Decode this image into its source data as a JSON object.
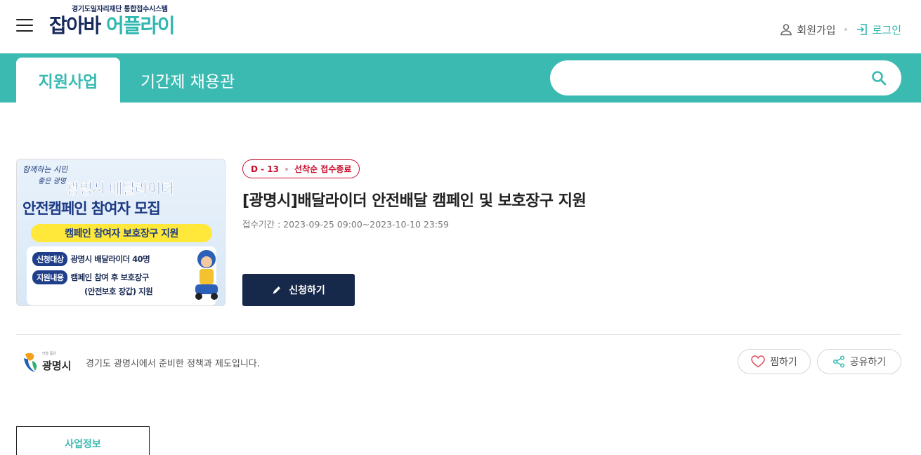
{
  "header": {
    "logo_subtitle": "경기도일자리재단 통합접수시스템",
    "logo_part1": "잡아바",
    "logo_part2": "어플라이",
    "signup_label": "회원가입",
    "login_label": "로그인"
  },
  "nav": {
    "tabs": [
      {
        "label": "지원사업",
        "active": true
      },
      {
        "label": "기간제 채용관",
        "active": false
      }
    ],
    "search": {
      "value": "",
      "placeholder": ""
    }
  },
  "program": {
    "dday": "D - 13",
    "status": "선착순 접수종료",
    "title": "[광명시]배달라이더 안전배달 캠페인 및 보호장구 지원",
    "period_label": "접수기간 :",
    "period_value": "2023-09-25 09:00~2023-10-10 23:59",
    "apply_label": "신청하기",
    "thumbnail": {
      "script_line1": "함께하는 시민",
      "script_line2": "좋은 광명",
      "headline1": "광명시 배달라이더",
      "headline2": "안전캠페인 참여자 모집",
      "band": "캠페인 참여자 보호장구 지원",
      "row1_tag": "신청대상",
      "row1_text": "광명시 배달라이더 40명",
      "row2_tag": "지원내용",
      "row2_text": "캠페인 참여 후 보호장구",
      "row3_text": "(안전보호 장갑) 지원"
    }
  },
  "org": {
    "logo_sub": "맛을 품은",
    "logo_name": "광명시",
    "description": "경기도 광명시에서 준비한 정책과 제도입니다."
  },
  "actions": {
    "like_label": "찜하기",
    "share_label": "공유하기"
  },
  "section_tab": {
    "label": "사업정보"
  },
  "colors": {
    "teal": "#3bbab2",
    "navy": "#17294a",
    "status_red": "#c8102e"
  }
}
